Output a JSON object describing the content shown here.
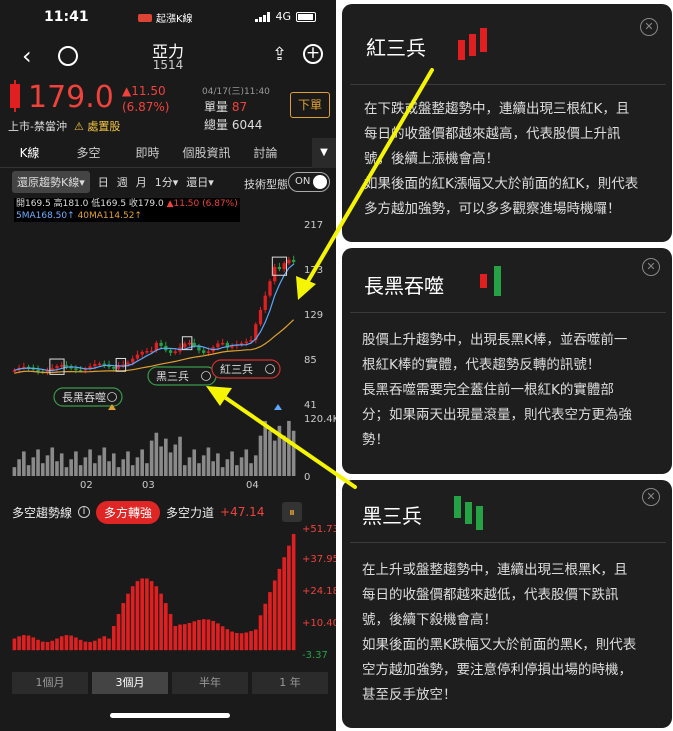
{
  "status": {
    "time": "11:41",
    "app_name": "起漲K線",
    "network": "4G"
  },
  "nav": {
    "stock_name": "亞力",
    "stock_code": "1514"
  },
  "quote": {
    "price": "179.0",
    "change": "▲11.50",
    "change_pct": "(6.87%)",
    "datetime": "04/17(三)11:40",
    "single_volume_label": "單量",
    "single_volume": "87",
    "total_volume_label": "總量",
    "total_volume": "6044",
    "order_button": "下單",
    "market": "上市-禁當沖",
    "warning": "⚠ 處置股"
  },
  "tabs": [
    "K線",
    "多空",
    "即時",
    "個股資訊",
    "討論"
  ],
  "toolbar": {
    "restore": "還原趨勢K線▾",
    "periods": [
      "日",
      "週",
      "月",
      "1分▾",
      "還日▾"
    ],
    "tech_label": "技術型態",
    "toggle": "ON"
  },
  "ohlc": {
    "open": "開169.5",
    "high": "高181.0",
    "low": "低169.5",
    "close": "收179.0",
    "chg": "▲11.50 (6.87%)",
    "ma5": "5MA168.50↑",
    "ma40": "40MA114.52↑"
  },
  "chart_data": {
    "type": "candlestick",
    "price_ticks": [
      "217",
      "173",
      "129",
      "85",
      "41"
    ],
    "volume_ticks": [
      "120.4K",
      "0"
    ],
    "x_ticks": [
      "02",
      "03",
      "04"
    ],
    "pattern_labels": [
      "長黑吞噬",
      "黑三兵",
      "紅三兵"
    ],
    "indicator_ticks": [
      "+51.73",
      "+37.95",
      "+24.18",
      "+10.40",
      "-3.37"
    ],
    "colors": {
      "up": "#e02020",
      "down": "#25a244",
      "ma_short": "#5aa8ff",
      "ma_long": "#e0a030",
      "volume": "#8a8a8a"
    }
  },
  "trend": {
    "label": "多空趨勢線",
    "badge": "多方轉強",
    "power_label": "多空力道",
    "power_value": "+47.14"
  },
  "ranges": [
    "1個月",
    "3個月",
    "半年",
    "1 年"
  ],
  "cards": [
    {
      "title": "紅三兵",
      "lines": [
        "在下跌或盤整趨勢中，連續出現三根紅K，且",
        "每日的收盤價都越來越高，代表股價上升訊",
        "號，後續上漲機會高！",
        "如果後面的紅K漲幅又大於前面的紅K，則代表",
        "多方越加強勢，可以多多觀察進場時機囉！"
      ]
    },
    {
      "title": "長黑吞噬",
      "lines": [
        "股價上升趨勢中，出現長黑K棒，並吞噬前一",
        "根紅K棒的實體，代表趨勢反轉的訊號！",
        "長黑吞噬需要完全蓋住前一根紅K的實體部",
        "分；如果兩天出現量滾量，則代表空方更為強",
        "勢！"
      ]
    },
    {
      "title": "黑三兵",
      "lines": [
        "在上升或盤整趨勢中，連續出現三根黑K，且",
        "每日的收盤價都越來越低，代表股價下跌訊",
        "號，後續下殺機會高！",
        "如果後面的黑K跌幅又大於前面的黑K，則代表",
        "空方越加強勢，要注意停利停損出場的時機，",
        "甚至反手放空！"
      ]
    }
  ]
}
